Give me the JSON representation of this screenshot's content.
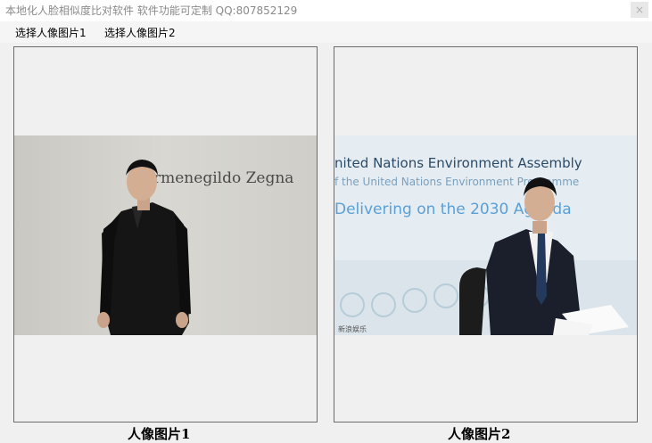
{
  "window": {
    "title": "本地化人脸相似度比对软件 软件功能可定制   QQ:807852129",
    "close_glyph": "×"
  },
  "menu": {
    "select_image1": "选择人像图片1",
    "select_image2": "选择人像图片2"
  },
  "panels": {
    "left": {
      "caption": "人像图片1",
      "backdrop_text": "rmenegildo Zegna"
    },
    "right": {
      "caption": "人像图片2",
      "banner_line1": "nited Nations Environment Assembly",
      "banner_line2": "f the United Nations Environment Programme",
      "banner_line3": "Delivering on the 2030 Agenda",
      "watermark": "新浪娱乐"
    }
  }
}
